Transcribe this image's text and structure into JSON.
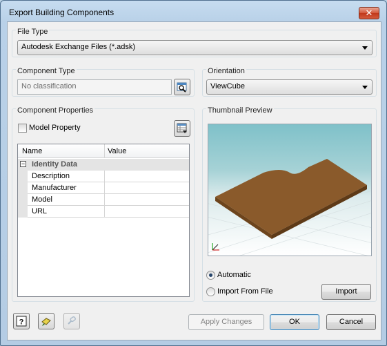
{
  "window": {
    "title": "Export Building Components",
    "close_glyph": "✕"
  },
  "file_type": {
    "label": "File Type",
    "selected": "Autodesk Exchange Files (*.adsk)"
  },
  "component_type": {
    "label": "Component Type",
    "placeholder": "No classification",
    "browse_icon": "browse-classification-icon"
  },
  "orientation": {
    "label": "Orientation",
    "selected": "ViewCube"
  },
  "component_properties": {
    "label": "Component Properties",
    "model_property_label": "Model Property",
    "model_property_checked": false,
    "columns": [
      "Name",
      "Value"
    ],
    "category": {
      "expander": "−",
      "name": "Identity Data"
    },
    "rows": [
      {
        "name": "Description",
        "value": ""
      },
      {
        "name": "Manufacturer",
        "value": ""
      },
      {
        "name": "Model",
        "value": ""
      },
      {
        "name": "URL",
        "value": ""
      }
    ]
  },
  "thumbnail": {
    "label": "Thumbnail Preview",
    "automatic_label": "Automatic",
    "import_from_file_label": "Import From File",
    "selected": "Automatic",
    "import_button": "Import"
  },
  "footer": {
    "apply_changes": "Apply Changes",
    "ok": "OK",
    "cancel": "Cancel",
    "icons": [
      "help-icon",
      "pick-icon",
      "link-icon"
    ]
  },
  "colors": {
    "accent": "#3c7fb1",
    "board": "#8a5a2b",
    "sky_top": "#7fc1c9"
  }
}
